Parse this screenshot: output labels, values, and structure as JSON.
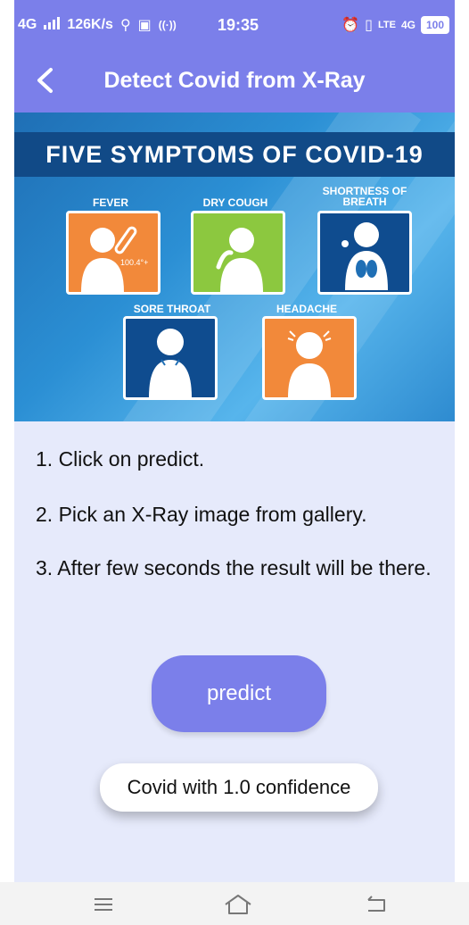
{
  "status_bar": {
    "network": "4G",
    "speed": "126K/s",
    "time": "19:35",
    "lte": "LTE",
    "net_badge": "4G",
    "battery": "100"
  },
  "app_bar": {
    "title": "Detect Covid from X-Ray"
  },
  "banner": {
    "title": "FIVE SYMPTOMS OF COVID-19",
    "symptoms": [
      "FEVER",
      "DRY COUGH",
      "SHORTNESS OF BREATH",
      "SORE THROAT",
      "HEADACHE"
    ],
    "fever_reading": "100.4°+"
  },
  "instructions": [
    "1. Click on predict.",
    "2. Pick an X-Ray image from gallery.",
    "3. After few seconds the result will be there."
  ],
  "predict_button": {
    "label": "predict"
  },
  "result": {
    "text": "Covid with 1.0 confidence"
  },
  "colors": {
    "accent": "#7b7fea",
    "background": "#e6eafb",
    "banner_blue": "#1f6fb5",
    "orange": "#f2893a",
    "green": "#8cc83f",
    "navy": "#0f4c8f"
  }
}
